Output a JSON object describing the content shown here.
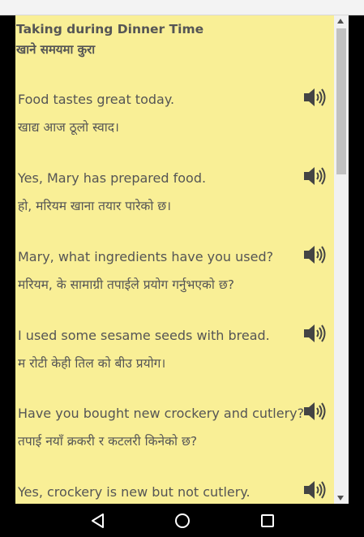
{
  "header": {
    "title_en": "Taking during Dinner Time",
    "title_np": "खाने समयमा कुरा"
  },
  "phrases": [
    {
      "en": "Food tastes great today.",
      "np": "खाद्य आज ठूलो स्वाद।"
    },
    {
      "en": "Yes, Mary has prepared food.",
      "np": "हो, मरियम खाना तयार पारेको छ।"
    },
    {
      "en": "Mary, what ingredients have you used?",
      "np": "मरियम, के सामाग्री तपाईले प्रयोग गर्नुभएको छ?"
    },
    {
      "en": "I used some sesame seeds with bread.",
      "np": "म रोटी केही तिल को बीउ प्रयोग।"
    },
    {
      "en": "Have you bought new crockery and cutlery?",
      "np": "तपाई नयाँ क्रकरी र कटलरी किनेको छ?"
    },
    {
      "en": "Yes, crockery is new but not cutlery.",
      "np": ""
    }
  ],
  "icons": {
    "speaker": "speaker-icon",
    "back": "back-triangle-icon",
    "home": "home-circle-icon",
    "recents": "recents-square-icon"
  },
  "colors": {
    "content_bg": "#f9ef96",
    "text": "#555555",
    "navbar": "#000000"
  }
}
